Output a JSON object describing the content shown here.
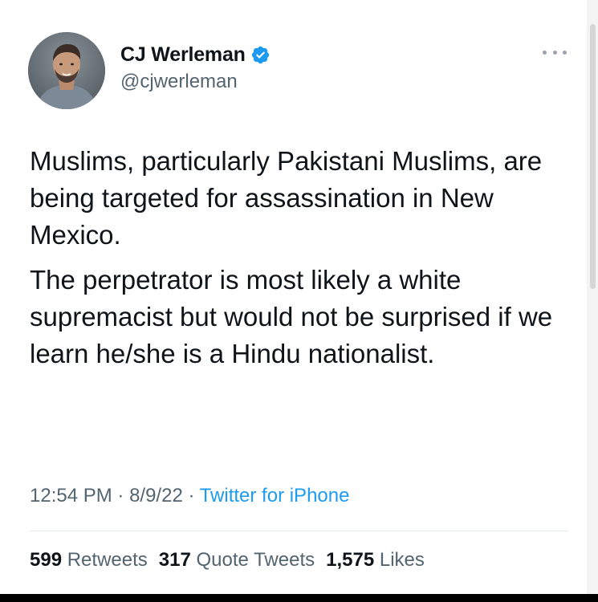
{
  "author": {
    "display_name": "CJ Werleman",
    "handle": "@cjwerleman",
    "verified_icon": "verified-badge-icon"
  },
  "tweet": {
    "paragraphs": [
      "Muslims, particularly Pakistani Muslims, are being targeted for assassination in New Mexico.",
      "The perpetrator is most likely a white supremacist but would not be surprised if we learn he/she is a Hindu nationalist."
    ]
  },
  "meta": {
    "time": "12:54 PM",
    "separator": " · ",
    "date": "8/9/22",
    "source": "Twitter for iPhone"
  },
  "stats": {
    "retweets_count": "599",
    "retweets_label": "Retweets",
    "quotes_count": "317",
    "quotes_label": "Quote Tweets",
    "likes_count": "1,575",
    "likes_label": "Likes"
  },
  "colors": {
    "text": "#0f1419",
    "secondary": "#536471",
    "accent": "#1d9bf0"
  }
}
